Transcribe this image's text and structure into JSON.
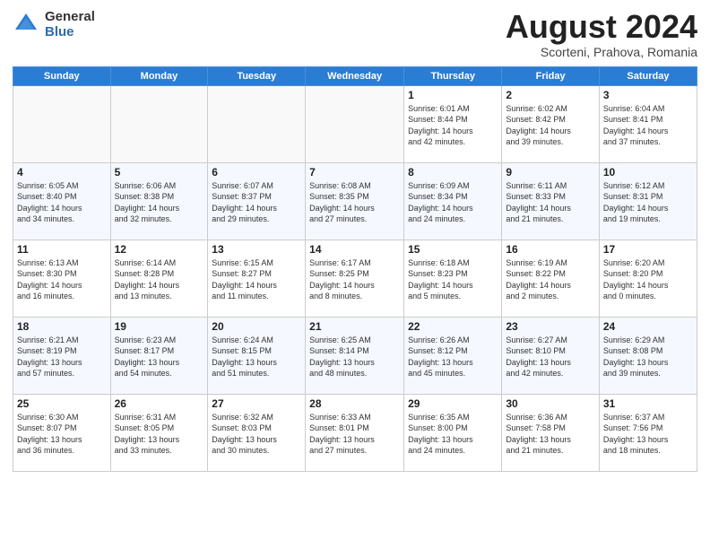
{
  "header": {
    "logo_general": "General",
    "logo_blue": "Blue",
    "month_title": "August 2024",
    "location": "Scorteni, Prahova, Romania"
  },
  "weekdays": [
    "Sunday",
    "Monday",
    "Tuesday",
    "Wednesday",
    "Thursday",
    "Friday",
    "Saturday"
  ],
  "weeks": [
    [
      {
        "day": "",
        "info": ""
      },
      {
        "day": "",
        "info": ""
      },
      {
        "day": "",
        "info": ""
      },
      {
        "day": "",
        "info": ""
      },
      {
        "day": "1",
        "info": "Sunrise: 6:01 AM\nSunset: 8:44 PM\nDaylight: 14 hours\nand 42 minutes."
      },
      {
        "day": "2",
        "info": "Sunrise: 6:02 AM\nSunset: 8:42 PM\nDaylight: 14 hours\nand 39 minutes."
      },
      {
        "day": "3",
        "info": "Sunrise: 6:04 AM\nSunset: 8:41 PM\nDaylight: 14 hours\nand 37 minutes."
      }
    ],
    [
      {
        "day": "4",
        "info": "Sunrise: 6:05 AM\nSunset: 8:40 PM\nDaylight: 14 hours\nand 34 minutes."
      },
      {
        "day": "5",
        "info": "Sunrise: 6:06 AM\nSunset: 8:38 PM\nDaylight: 14 hours\nand 32 minutes."
      },
      {
        "day": "6",
        "info": "Sunrise: 6:07 AM\nSunset: 8:37 PM\nDaylight: 14 hours\nand 29 minutes."
      },
      {
        "day": "7",
        "info": "Sunrise: 6:08 AM\nSunset: 8:35 PM\nDaylight: 14 hours\nand 27 minutes."
      },
      {
        "day": "8",
        "info": "Sunrise: 6:09 AM\nSunset: 8:34 PM\nDaylight: 14 hours\nand 24 minutes."
      },
      {
        "day": "9",
        "info": "Sunrise: 6:11 AM\nSunset: 8:33 PM\nDaylight: 14 hours\nand 21 minutes."
      },
      {
        "day": "10",
        "info": "Sunrise: 6:12 AM\nSunset: 8:31 PM\nDaylight: 14 hours\nand 19 minutes."
      }
    ],
    [
      {
        "day": "11",
        "info": "Sunrise: 6:13 AM\nSunset: 8:30 PM\nDaylight: 14 hours\nand 16 minutes."
      },
      {
        "day": "12",
        "info": "Sunrise: 6:14 AM\nSunset: 8:28 PM\nDaylight: 14 hours\nand 13 minutes."
      },
      {
        "day": "13",
        "info": "Sunrise: 6:15 AM\nSunset: 8:27 PM\nDaylight: 14 hours\nand 11 minutes."
      },
      {
        "day": "14",
        "info": "Sunrise: 6:17 AM\nSunset: 8:25 PM\nDaylight: 14 hours\nand 8 minutes."
      },
      {
        "day": "15",
        "info": "Sunrise: 6:18 AM\nSunset: 8:23 PM\nDaylight: 14 hours\nand 5 minutes."
      },
      {
        "day": "16",
        "info": "Sunrise: 6:19 AM\nSunset: 8:22 PM\nDaylight: 14 hours\nand 2 minutes."
      },
      {
        "day": "17",
        "info": "Sunrise: 6:20 AM\nSunset: 8:20 PM\nDaylight: 14 hours\nand 0 minutes."
      }
    ],
    [
      {
        "day": "18",
        "info": "Sunrise: 6:21 AM\nSunset: 8:19 PM\nDaylight: 13 hours\nand 57 minutes."
      },
      {
        "day": "19",
        "info": "Sunrise: 6:23 AM\nSunset: 8:17 PM\nDaylight: 13 hours\nand 54 minutes."
      },
      {
        "day": "20",
        "info": "Sunrise: 6:24 AM\nSunset: 8:15 PM\nDaylight: 13 hours\nand 51 minutes."
      },
      {
        "day": "21",
        "info": "Sunrise: 6:25 AM\nSunset: 8:14 PM\nDaylight: 13 hours\nand 48 minutes."
      },
      {
        "day": "22",
        "info": "Sunrise: 6:26 AM\nSunset: 8:12 PM\nDaylight: 13 hours\nand 45 minutes."
      },
      {
        "day": "23",
        "info": "Sunrise: 6:27 AM\nSunset: 8:10 PM\nDaylight: 13 hours\nand 42 minutes."
      },
      {
        "day": "24",
        "info": "Sunrise: 6:29 AM\nSunset: 8:08 PM\nDaylight: 13 hours\nand 39 minutes."
      }
    ],
    [
      {
        "day": "25",
        "info": "Sunrise: 6:30 AM\nSunset: 8:07 PM\nDaylight: 13 hours\nand 36 minutes."
      },
      {
        "day": "26",
        "info": "Sunrise: 6:31 AM\nSunset: 8:05 PM\nDaylight: 13 hours\nand 33 minutes."
      },
      {
        "day": "27",
        "info": "Sunrise: 6:32 AM\nSunset: 8:03 PM\nDaylight: 13 hours\nand 30 minutes."
      },
      {
        "day": "28",
        "info": "Sunrise: 6:33 AM\nSunset: 8:01 PM\nDaylight: 13 hours\nand 27 minutes."
      },
      {
        "day": "29",
        "info": "Sunrise: 6:35 AM\nSunset: 8:00 PM\nDaylight: 13 hours\nand 24 minutes."
      },
      {
        "day": "30",
        "info": "Sunrise: 6:36 AM\nSunset: 7:58 PM\nDaylight: 13 hours\nand 21 minutes."
      },
      {
        "day": "31",
        "info": "Sunrise: 6:37 AM\nSunset: 7:56 PM\nDaylight: 13 hours\nand 18 minutes."
      }
    ]
  ]
}
